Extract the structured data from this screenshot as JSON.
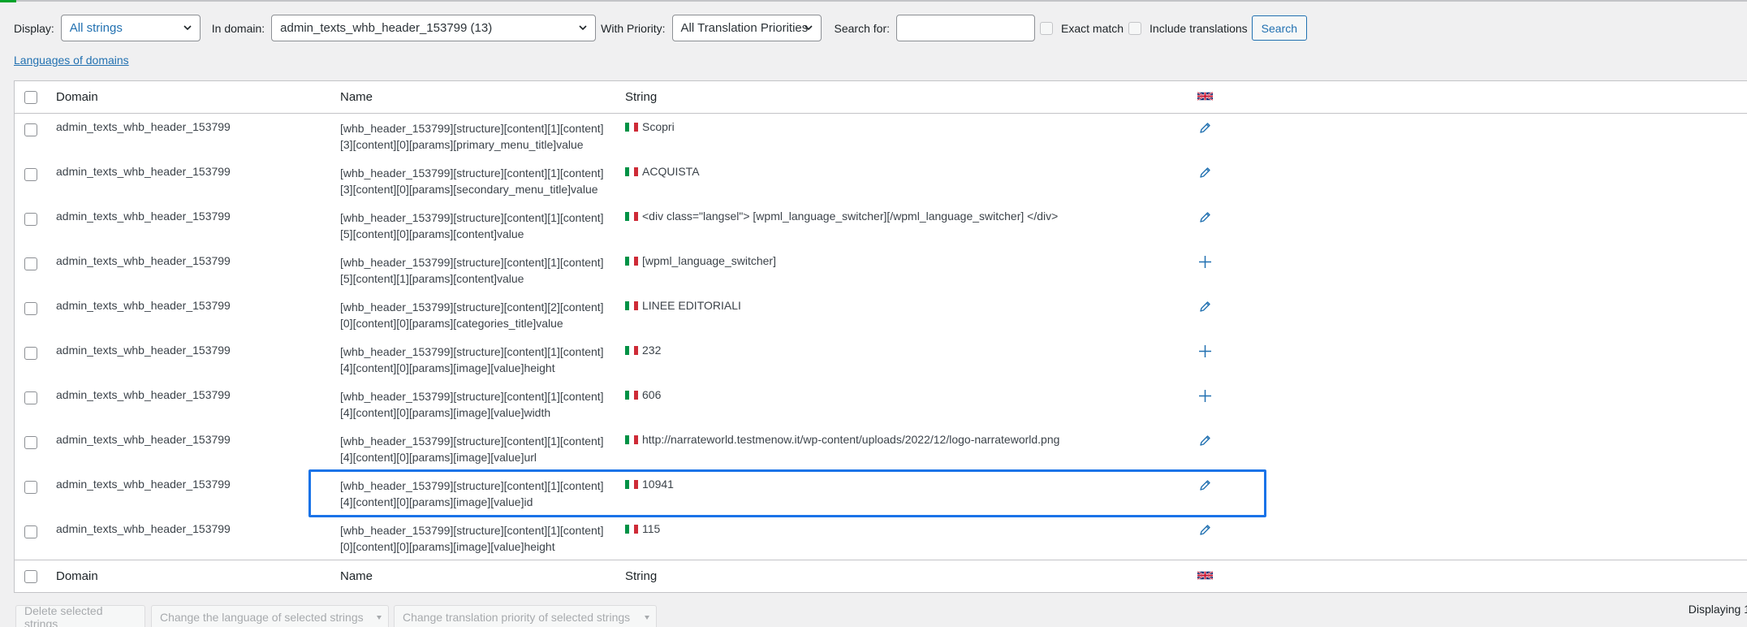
{
  "filters": {
    "display_label": "Display:",
    "display_value": "All strings",
    "domain_label": "In domain:",
    "domain_value": "admin_texts_whb_header_153799 (13)",
    "priority_label": "With Priority:",
    "priority_value": "All Translation Priorities",
    "search_label": "Search for:",
    "search_value": "",
    "exact_match_label": "Exact match",
    "include_translations_label": "Include translations",
    "search_button": "Search"
  },
  "languages_link": "Languages of domains",
  "table": {
    "headers": {
      "domain": "Domain",
      "name": "Name",
      "string": "String"
    },
    "rows": [
      {
        "domain": "admin_texts_whb_header_153799",
        "name1": "[whb_header_153799][structure][content][1][content]",
        "name2": "[3][content][0][params][primary_menu_title]value",
        "string": "Scopri",
        "action": "edit-icon"
      },
      {
        "domain": "admin_texts_whb_header_153799",
        "name1": "[whb_header_153799][structure][content][1][content]",
        "name2": "[3][content][0][params][secondary_menu_title]value",
        "string": "ACQUISTA",
        "action": "edit-icon"
      },
      {
        "domain": "admin_texts_whb_header_153799",
        "name1": "[whb_header_153799][structure][content][1][content]",
        "name2": "[5][content][0][params][content]value",
        "string": "<div class=\"langsel\"> [wpml_language_switcher][/wpml_language_switcher] </div>",
        "action": "edit-icon"
      },
      {
        "domain": "admin_texts_whb_header_153799",
        "name1": "[whb_header_153799][structure][content][1][content]",
        "name2": "[5][content][1][params][content]value",
        "string": "[wpml_language_switcher]",
        "action": "add-icon"
      },
      {
        "domain": "admin_texts_whb_header_153799",
        "name1": "[whb_header_153799][structure][content][2][content]",
        "name2": "[0][content][0][params][categories_title]value",
        "string": "LINEE EDITORIALI",
        "action": "edit-icon"
      },
      {
        "domain": "admin_texts_whb_header_153799",
        "name1": "[whb_header_153799][structure][content][1][content]",
        "name2": "[4][content][0][params][image][value]height",
        "string": "232",
        "action": "add-icon"
      },
      {
        "domain": "admin_texts_whb_header_153799",
        "name1": "[whb_header_153799][structure][content][1][content]",
        "name2": "[4][content][0][params][image][value]width",
        "string": "606",
        "action": "add-icon"
      },
      {
        "domain": "admin_texts_whb_header_153799",
        "name1": "[whb_header_153799][structure][content][1][content]",
        "name2": "[4][content][0][params][image][value]url",
        "string": "http://narrateworld.testmenow.it/wp-content/uploads/2022/12/logo-narrateworld.png",
        "action": "edit-icon"
      },
      {
        "domain": "admin_texts_whb_header_153799",
        "name1": "[whb_header_153799][structure][content][1][content]",
        "name2": "[4][content][0][params][image][value]id",
        "string": "10941",
        "action": "edit-icon"
      },
      {
        "domain": "admin_texts_whb_header_153799",
        "name1": "[whb_header_153799][structure][content][1][content]",
        "name2": "[0][content][0][params][image][value]height",
        "string": "115",
        "action": "edit-icon"
      }
    ]
  },
  "bulk": {
    "delete": "Delete selected strings",
    "change_language": "Change the language of selected strings",
    "change_priority": "Change translation priority of selected strings"
  },
  "displaying": "Displaying 1",
  "colors": {
    "accent": "#2271b1",
    "highlight": "#1a73e8"
  }
}
